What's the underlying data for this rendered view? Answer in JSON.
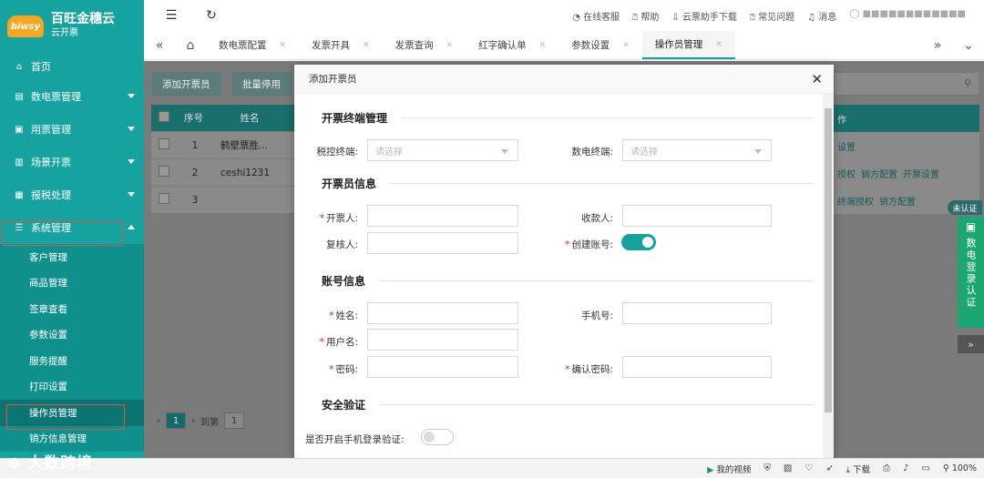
{
  "brand": {
    "logo": "biwsy",
    "title": "百旺金穗云",
    "subtitle": "云开票"
  },
  "sidebar": {
    "home": "首页",
    "groups": [
      {
        "label": "数电票管理",
        "icon": "invoice-icon"
      },
      {
        "label": "用票管理",
        "icon": "ticket-icon"
      },
      {
        "label": "场景开票",
        "icon": "scene-icon"
      },
      {
        "label": "报税处理",
        "icon": "tax-icon"
      },
      {
        "label": "系统管理",
        "icon": "settings-icon"
      }
    ],
    "sub_items": [
      "客户管理",
      "商品管理",
      "签章查看",
      "参数设置",
      "服务提醒",
      "打印设置",
      "操作员管理",
      "销方信息管理"
    ]
  },
  "topbar": {
    "links": [
      "在线客服",
      "帮助",
      "云票助手下载",
      "常见问题",
      "消息"
    ],
    "user": "■■■■■■■■■■■■"
  },
  "tabs": [
    {
      "label": "数电票配置"
    },
    {
      "label": "发票开具"
    },
    {
      "label": "发票查询"
    },
    {
      "label": "红字确认单"
    },
    {
      "label": "参数设置"
    },
    {
      "label": "操作员管理"
    }
  ],
  "background": {
    "buttons": [
      "添加开票员",
      "批量停用"
    ],
    "table_headers": [
      "序号",
      "姓名"
    ],
    "rows": [
      {
        "no": "1",
        "name": "鹤壁票胜..."
      },
      {
        "no": "2",
        "name": "ceshi1231"
      },
      {
        "no": "3",
        "name": ""
      }
    ],
    "right_header": "作",
    "right_rows": [
      [
        "设置"
      ],
      [
        "授权",
        "销方配置",
        "开票设置"
      ],
      [
        "终端授权",
        "销方配置"
      ]
    ],
    "pager": {
      "current": "1",
      "goto_label": "到第",
      "goto_value": "1"
    }
  },
  "modal": {
    "title": "添加开票员",
    "sections": {
      "terminal": "开票终端管理",
      "issuer": "开票员信息",
      "account": "账号信息",
      "security": "安全验证"
    },
    "fields": {
      "tax_terminal": {
        "label": "税控终端:",
        "placeholder": "请选择"
      },
      "digital_terminal": {
        "label": "数电终端:",
        "placeholder": "请选择"
      },
      "issuer": {
        "label": "开票人:"
      },
      "payee": {
        "label": "收款人:"
      },
      "reviewer": {
        "label": "复核人:"
      },
      "create_account": {
        "label": "创建账号:",
        "on": true
      },
      "name": {
        "label": "姓名:"
      },
      "phone": {
        "label": "手机号:"
      },
      "username": {
        "label": "用户名:"
      },
      "password": {
        "label": "密码:"
      },
      "confirm_password": {
        "label": "确认密码:"
      },
      "sms_login": {
        "label": "是否开启手机登录验证:",
        "on": false
      }
    }
  },
  "auth_float": {
    "tag": "未认证",
    "text": "数电登录认证"
  },
  "statusbar": {
    "video": "我的视频",
    "download": "下载",
    "zoom": "100%"
  },
  "watermark": "大数跨境",
  "colors": {
    "primary": "#16a3a0",
    "required": "#e02020",
    "auth_green": "#1aa772"
  }
}
